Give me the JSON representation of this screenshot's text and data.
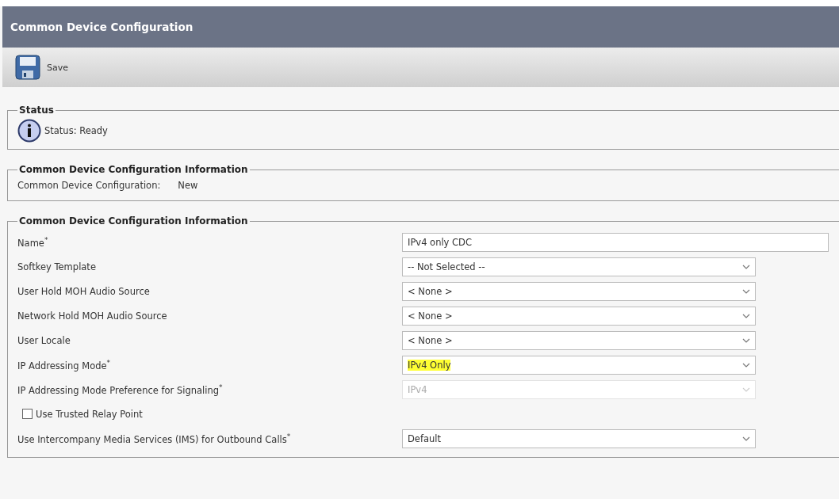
{
  "window": {
    "title": "Common Device Configuration"
  },
  "toolbar": {
    "buttons": [
      {
        "label": "Save"
      }
    ]
  },
  "status_section": {
    "legend": "Status",
    "message": "Status: Ready"
  },
  "info_section": {
    "legend": "Common Device Configuration Information",
    "label": "Common Device Configuration:",
    "value": "New"
  },
  "form_section": {
    "legend": "Common Device Configuration Information",
    "fields": [
      {
        "kind": "text",
        "label": "Name$^{*}$",
        "value": "IPv4 only CDC"
      },
      {
        "kind": "select",
        "label": "Softkey Template",
        "value": "-- Not Selected --",
        "highlighted": false,
        "disabled": false
      },
      {
        "kind": "select",
        "label": "User Hold MOH Audio Source",
        "value": "< None >",
        "highlighted": false,
        "disabled": false
      },
      {
        "kind": "select",
        "label": "Network Hold MOH Audio Source",
        "value": "< None >",
        "highlighted": false,
        "disabled": false
      },
      {
        "kind": "select",
        "label": "User Locale",
        "value": "< None >",
        "highlighted": false,
        "disabled": false
      },
      {
        "kind": "select",
        "label": "IP Addressing Mode$^{*}$",
        "value": "IPv4 Only",
        "highlighted": true,
        "disabled": false
      },
      {
        "kind": "select",
        "label": "IP Addressing Mode Preference for Signaling$^{*}$",
        "value": "IPv4",
        "highlighted": false,
        "disabled": true
      },
      {
        "kind": "checkbox",
        "label": "Use Trusted Relay Point",
        "checked": false
      },
      {
        "kind": "select",
        "label": "Use Intercompany Media Services (IMS) for Outbound Calls$^{*}$",
        "value": "Default",
        "highlighted": false,
        "disabled": false
      }
    ]
  }
}
